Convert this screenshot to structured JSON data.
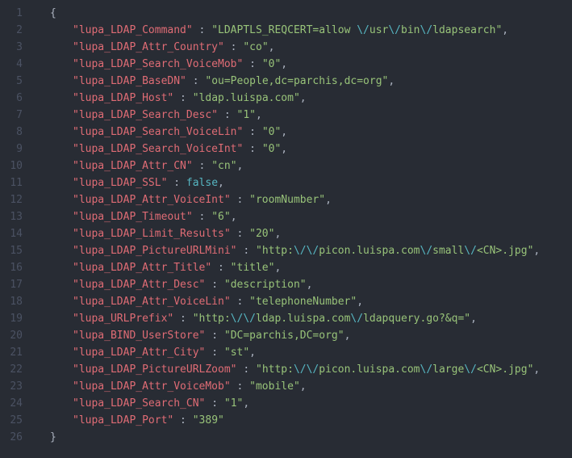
{
  "lines": {
    "total": 26
  },
  "code": {
    "open_brace": "{",
    "close_brace": "}",
    "colon": " : ",
    "comma": ",",
    "false_literal": "false",
    "entries": [
      {
        "key": "lupa_LDAP_Command",
        "type": "string",
        "segments": [
          "LDAPTLS_REQCERT=allow ",
          {
            "esc": "\\/"
          },
          "usr",
          {
            "esc": "\\/"
          },
          "bin",
          {
            "esc": "\\/"
          },
          "ldapsearch"
        ]
      },
      {
        "key": "lupa_LDAP_Attr_Country",
        "type": "string",
        "segments": [
          "co"
        ]
      },
      {
        "key": "lupa_LDAP_Search_VoiceMob",
        "type": "string",
        "segments": [
          "0"
        ]
      },
      {
        "key": "lupa_LDAP_BaseDN",
        "type": "string",
        "segments": [
          "ou=People,dc=parchis,dc=org"
        ]
      },
      {
        "key": "lupa_LDAP_Host",
        "type": "string",
        "segments": [
          "ldap.luispa.com"
        ]
      },
      {
        "key": "lupa_LDAP_Search_Desc",
        "type": "string",
        "segments": [
          "1"
        ]
      },
      {
        "key": "lupa_LDAP_Search_VoiceLin",
        "type": "string",
        "segments": [
          "0"
        ]
      },
      {
        "key": "lupa_LDAP_Search_VoiceInt",
        "type": "string",
        "segments": [
          "0"
        ]
      },
      {
        "key": "lupa_LDAP_Attr_CN",
        "type": "string",
        "segments": [
          "cn"
        ]
      },
      {
        "key": "lupa_LDAP_SSL",
        "type": "bool"
      },
      {
        "key": "lupa_LDAP_Attr_VoiceInt",
        "type": "string",
        "segments": [
          "roomNumber"
        ]
      },
      {
        "key": "lupa_LDAP_Timeout",
        "type": "string",
        "segments": [
          "6"
        ]
      },
      {
        "key": "lupa_LDAP_Limit_Results",
        "type": "string",
        "segments": [
          "20"
        ]
      },
      {
        "key": "lupa_LDAP_PictureURLMini",
        "type": "string",
        "segments": [
          "http:",
          {
            "esc": "\\/"
          },
          {
            "esc": "\\/"
          },
          "picon.luispa.com",
          {
            "esc": "\\/"
          },
          "small",
          {
            "esc": "\\/"
          },
          "<CN>.jpg"
        ]
      },
      {
        "key": "lupa_LDAP_Attr_Title",
        "type": "string",
        "segments": [
          "title"
        ]
      },
      {
        "key": "lupa_LDAP_Attr_Desc",
        "type": "string",
        "segments": [
          "description"
        ]
      },
      {
        "key": "lupa_LDAP_Attr_VoiceLin",
        "type": "string",
        "segments": [
          "telephoneNumber"
        ]
      },
      {
        "key": "lupa_URLPrefix",
        "type": "string",
        "segments": [
          "http:",
          {
            "esc": "\\/"
          },
          {
            "esc": "\\/"
          },
          "ldap.luispa.com",
          {
            "esc": "\\/"
          },
          "ldapquery.go?&q="
        ]
      },
      {
        "key": "lupa_BIND_UserStore",
        "type": "string",
        "segments": [
          "DC=parchis,DC=org"
        ]
      },
      {
        "key": "lupa_LDAP_Attr_City",
        "type": "string",
        "segments": [
          "st"
        ]
      },
      {
        "key": "lupa_LDAP_PictureURLZoom",
        "type": "string",
        "segments": [
          "http:",
          {
            "esc": "\\/"
          },
          {
            "esc": "\\/"
          },
          "picon.luispa.com",
          {
            "esc": "\\/"
          },
          "large",
          {
            "esc": "\\/"
          },
          "<CN>.jpg"
        ]
      },
      {
        "key": "lupa_LDAP_Attr_VoiceMob",
        "type": "string",
        "segments": [
          "mobile"
        ]
      },
      {
        "key": "lupa_LDAP_Search_CN",
        "type": "string",
        "segments": [
          "1"
        ]
      },
      {
        "key": "lupa_LDAP_Port",
        "type": "string",
        "segments": [
          "389"
        ],
        "last": true
      }
    ]
  }
}
